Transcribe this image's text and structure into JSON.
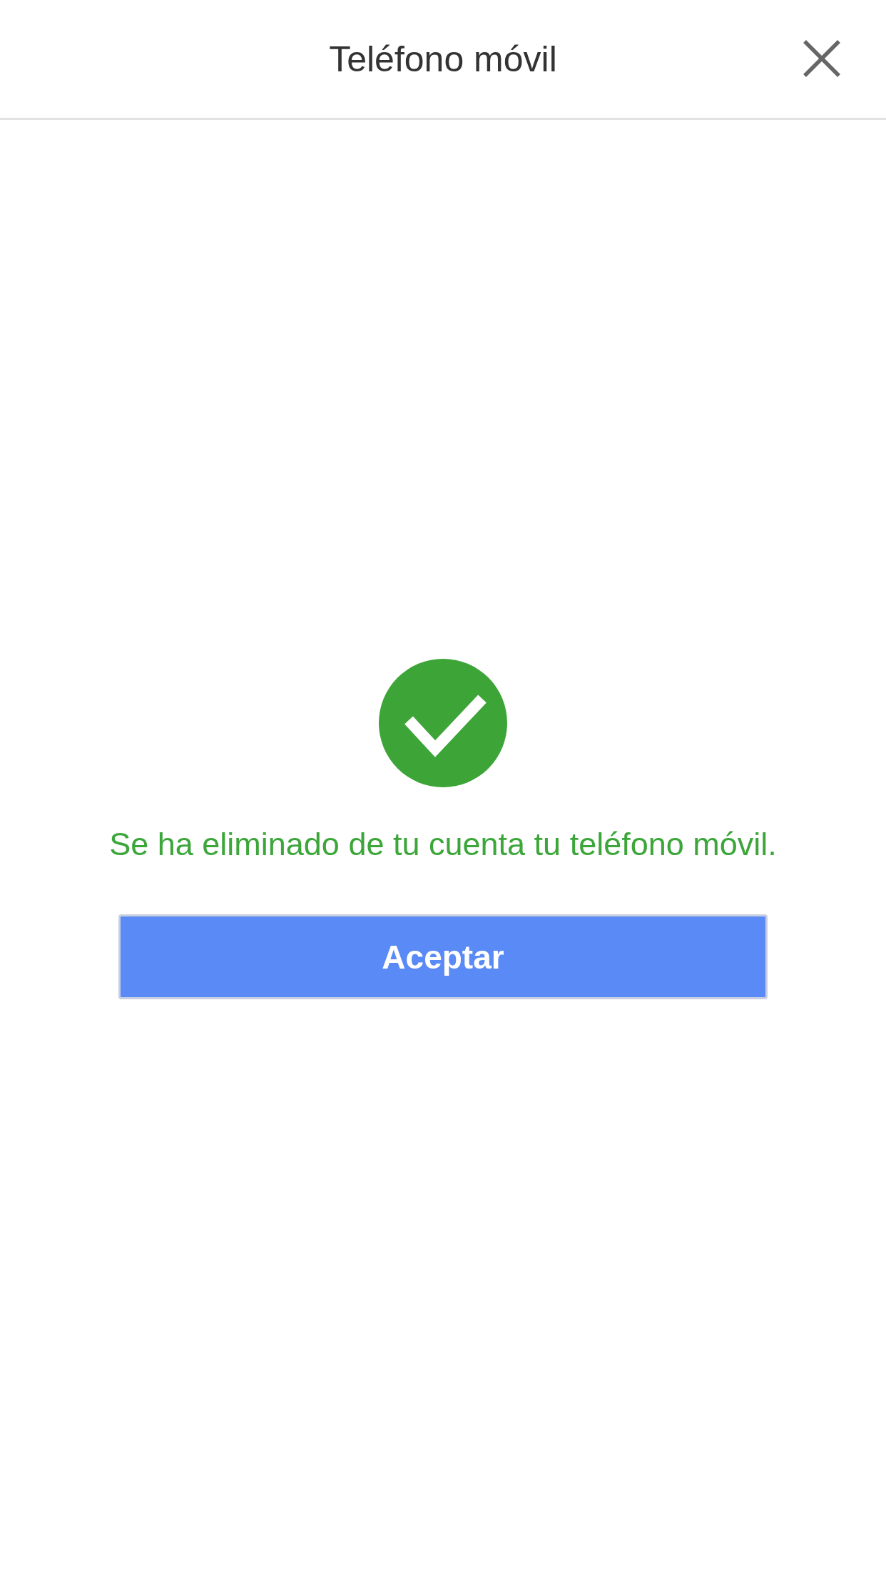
{
  "header": {
    "title": "Teléfono móvil"
  },
  "message": "Se ha eliminado de tu cuenta tu teléfono móvil.",
  "buttons": [
    {
      "label": "Aceptar"
    }
  ]
}
